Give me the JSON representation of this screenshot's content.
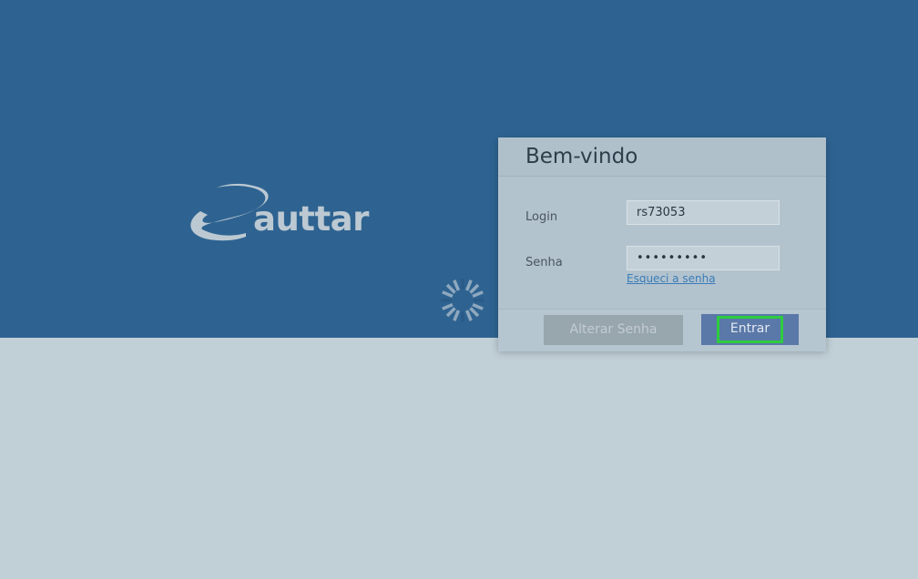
{
  "brand": {
    "logo_text": "auttar"
  },
  "login_panel": {
    "title": "Bem-vindo",
    "login_label": "Login",
    "login_value": "rs73053",
    "password_label": "Senha",
    "password_value": "•••••••••",
    "forgot_password_link": "Esqueci a senha",
    "change_password_button": "Alterar Senha",
    "submit_button": "Entrar"
  },
  "loading": {
    "icon": "spinner-icon"
  },
  "colors": {
    "top_band": "#2e6391",
    "page_background": "#c1d0d7",
    "panel_background": "#b3c3ce",
    "submit_button": "#5a78a8",
    "focus_ring": "#2ecc40",
    "link": "#3a7cb8"
  }
}
